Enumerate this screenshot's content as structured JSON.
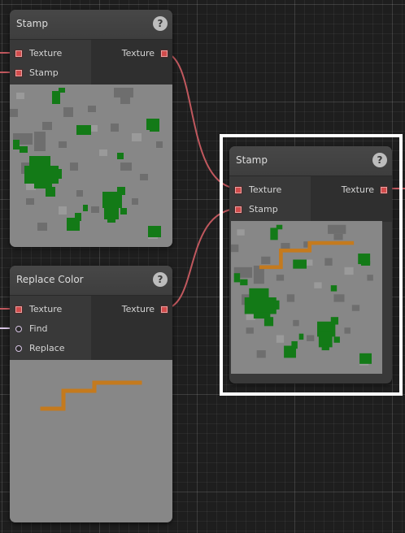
{
  "nodes": {
    "stamp_left": {
      "title": "Stamp",
      "help": "?",
      "inputs": [
        "Texture",
        "Stamp"
      ],
      "output": "Texture"
    },
    "replace_color": {
      "title": "Replace Color",
      "help": "?",
      "inputs": [
        "Texture",
        "Find",
        "Replace"
      ],
      "output": "Texture"
    },
    "stamp_selected": {
      "title": "Stamp",
      "help": "?",
      "inputs": [
        "Texture",
        "Stamp"
      ],
      "output": "Texture"
    }
  },
  "colors": {
    "wire": "#c0585e",
    "socket": "#d24c4c",
    "preview_bg": "#878787",
    "noise_dark": "#6e6e6e",
    "noise_light": "#9a9a9a",
    "stamp_green": "#137a17",
    "path_orange": "#c47a1e"
  },
  "icons": {
    "help": "help-icon",
    "socket_texture": "square-socket-icon",
    "socket_color": "round-socket-icon"
  }
}
